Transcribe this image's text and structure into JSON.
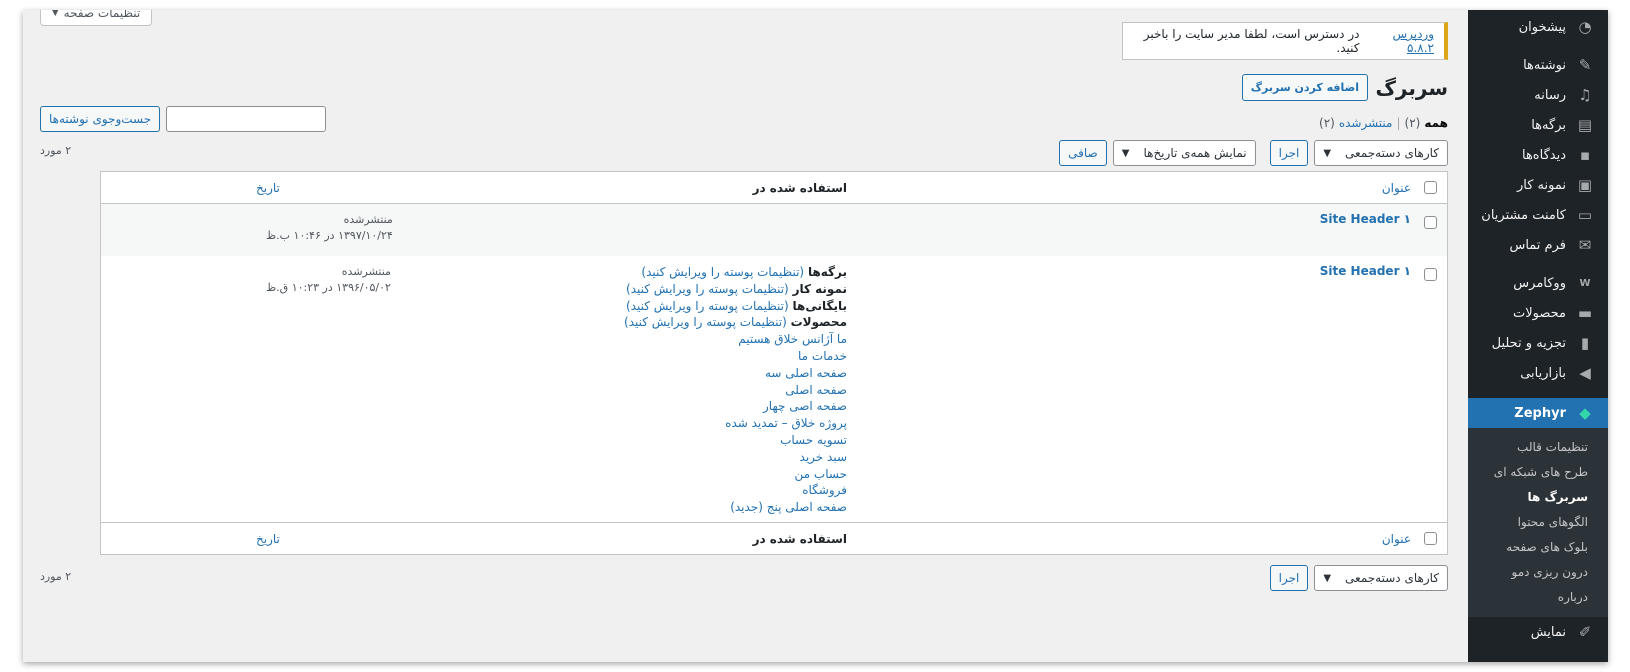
{
  "sidebar": {
    "items": [
      {
        "label": "پیشخوان",
        "icon": "dashboard-icon"
      },
      {
        "label": "نوشته‌ها",
        "icon": "pin-icon"
      },
      {
        "label": "رسانه",
        "icon": "media-icon"
      },
      {
        "label": "برگه‌ها",
        "icon": "pages-icon"
      },
      {
        "label": "دیدگاه‌ها",
        "icon": "comments-icon"
      },
      {
        "label": "نمونه کار",
        "icon": "portfolio-icon"
      },
      {
        "label": "کامنت مشتریان",
        "icon": "testimonial-icon"
      },
      {
        "label": "فرم تماس",
        "icon": "mail-icon"
      },
      {
        "label": "ووکامرس",
        "icon": "woo-icon"
      },
      {
        "label": "محصولات",
        "icon": "products-icon"
      },
      {
        "label": "تجزیه و تحلیل",
        "icon": "analytics-icon"
      },
      {
        "label": "بازاریابی",
        "icon": "megaphone-icon"
      }
    ],
    "current": {
      "label": "Zephyr",
      "icon": "diamond-icon"
    },
    "submenu": [
      "تنظیمات قالب",
      "طرح های شبکه ای",
      "سربرگ ها",
      "الگوهای محتوا",
      "بلوک های صفحه",
      "درون ریزی دمو",
      "درباره"
    ],
    "submenu_active": "سربرگ ها",
    "bottom": {
      "label": "نمایش",
      "icon": "brush-icon"
    }
  },
  "screen_options": "تنظیمات صفحه",
  "notice": {
    "prefix": "وردپرس",
    "version": "۵.۸.۲",
    "text": "در دسترس است، لطفا مدیر سایت را باخبر کنید."
  },
  "page": {
    "title": "سربرگ ها",
    "add_new": "اضافه کردن سربرگ"
  },
  "filters": {
    "all_label": "همه",
    "all_count": "(۲)",
    "separator": "|",
    "published_label": "منتشرشده",
    "published_count": "(۲)"
  },
  "search": {
    "button": "جست‌وجوی نوشته‌ها",
    "value": ""
  },
  "tablenav_top": {
    "bulk": "کارهای دسته‌جمعی",
    "apply": "اجرا",
    "dates": "نمایش همه‌ی تاریخ‌ها",
    "filter": "صافی",
    "count": "۲ مورد"
  },
  "table": {
    "columns": {
      "title": "عنوان",
      "used_in": "استفاده شده در",
      "date": "تاریخ"
    },
    "rows": [
      {
        "title": "Site Header ۱",
        "status": "منتشرشده",
        "date": "۱۳۹۷/۱۰/۲۴ در ۱۰:۴۶ ب.ظ",
        "used_in": []
      },
      {
        "title": "Site Header ۱",
        "status": "منتشرشده",
        "date": "۱۳۹۶/۰۵/۰۲ در ۱۰:۲۳ ق.ظ",
        "used_in_labeled": [
          {
            "label": "برگه‌ها",
            "link": "(تنظیمات پوسته را ویرایش کنید)"
          },
          {
            "label": "نمونه کار",
            "link": "(تنظیمات پوسته را ویرایش کنید)"
          },
          {
            "label": "بایگانی‌ها",
            "link": "(تنظیمات پوسته را ویرایش کنید)"
          },
          {
            "label": "محصولات",
            "link": "(تنظیمات پوسته را ویرایش کنید)"
          }
        ],
        "used_in_pages": [
          "ما آژانس خلاق هستیم",
          "خدمات ما",
          "صفحه اصلی سه",
          "صفحه اصلی",
          "صفحه اصی چهار",
          "پروژه خلاق – تمدید شده",
          "تسویه حساب",
          "سبد خرید",
          "حساب من",
          "فروشگاه",
          "صفحه اصلی پنج (جدید)"
        ]
      }
    ]
  },
  "tablenav_bottom": {
    "bulk": "کارهای دسته‌جمعی",
    "apply": "اجرا",
    "count": "۲ مورد"
  },
  "colors": {
    "admin_bar": "#1d2327",
    "accent": "#2271b1",
    "notice_border": "#dba617",
    "zephyr_icon": "#33d6a8"
  }
}
